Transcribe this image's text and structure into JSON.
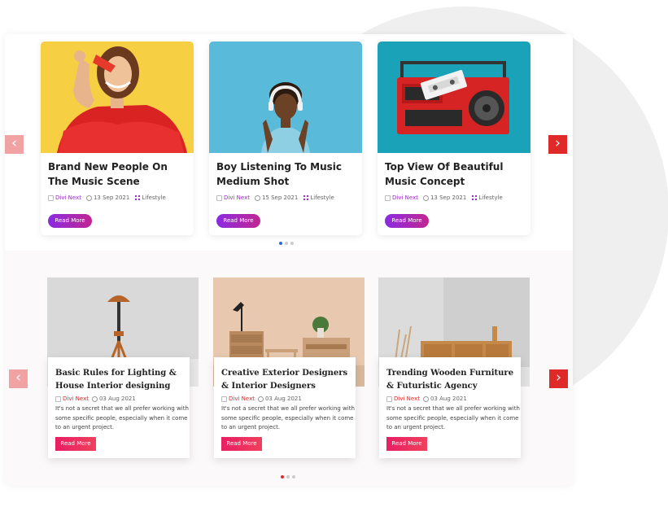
{
  "section1": {
    "cards": [
      {
        "title": "Brand New People On The Music Scene",
        "author": "Divi Next",
        "date": "13 Sep 2021",
        "category": "Lifestyle",
        "button": "Read More"
      },
      {
        "title": "Boy Listening To Music Medium Shot",
        "author": "Divi Next",
        "date": "15 Sep 2021",
        "category": "Lifestyle",
        "button": "Read More"
      },
      {
        "title": "Top View Of Beautiful Music Concept",
        "author": "Divi Next",
        "date": "13 Sep 2021",
        "category": "Lifestyle",
        "button": "Read More"
      }
    ],
    "prev_arrow": "‹",
    "next_arrow": "›",
    "dots": 3,
    "active_dot": 0
  },
  "section2": {
    "cards": [
      {
        "title": "Basic Rules for Lighting & House Interior designing",
        "author": "Divi Next",
        "date": "03 Aug 2021",
        "excerpt": "It's not a secret that we all prefer working with some specific people, especially when it come to an urgent project.",
        "button": "Read More"
      },
      {
        "title": "Creative Exterior Designers & Interior Designers",
        "author": "Divi Next",
        "date": "03 Aug 2021",
        "excerpt": "It's not a secret that we all prefer working with some specific people, especially when it come to an urgent project.",
        "button": "Read More"
      },
      {
        "title": "Trending Wooden Furniture & Futuristic Agency",
        "author": "Divi Next",
        "date": "03 Aug 2021",
        "excerpt": "It's not a secret that we all prefer working with some specific people, especially when it come to an urgent project.",
        "button": "Read More"
      }
    ],
    "prev_arrow": "‹",
    "next_arrow": "›",
    "dots": 3,
    "active_dot": 0
  },
  "colors": {
    "accent_purple": "#9b2dc9",
    "accent_red": "#e02a2a",
    "accent_pink": "#e91e63"
  }
}
